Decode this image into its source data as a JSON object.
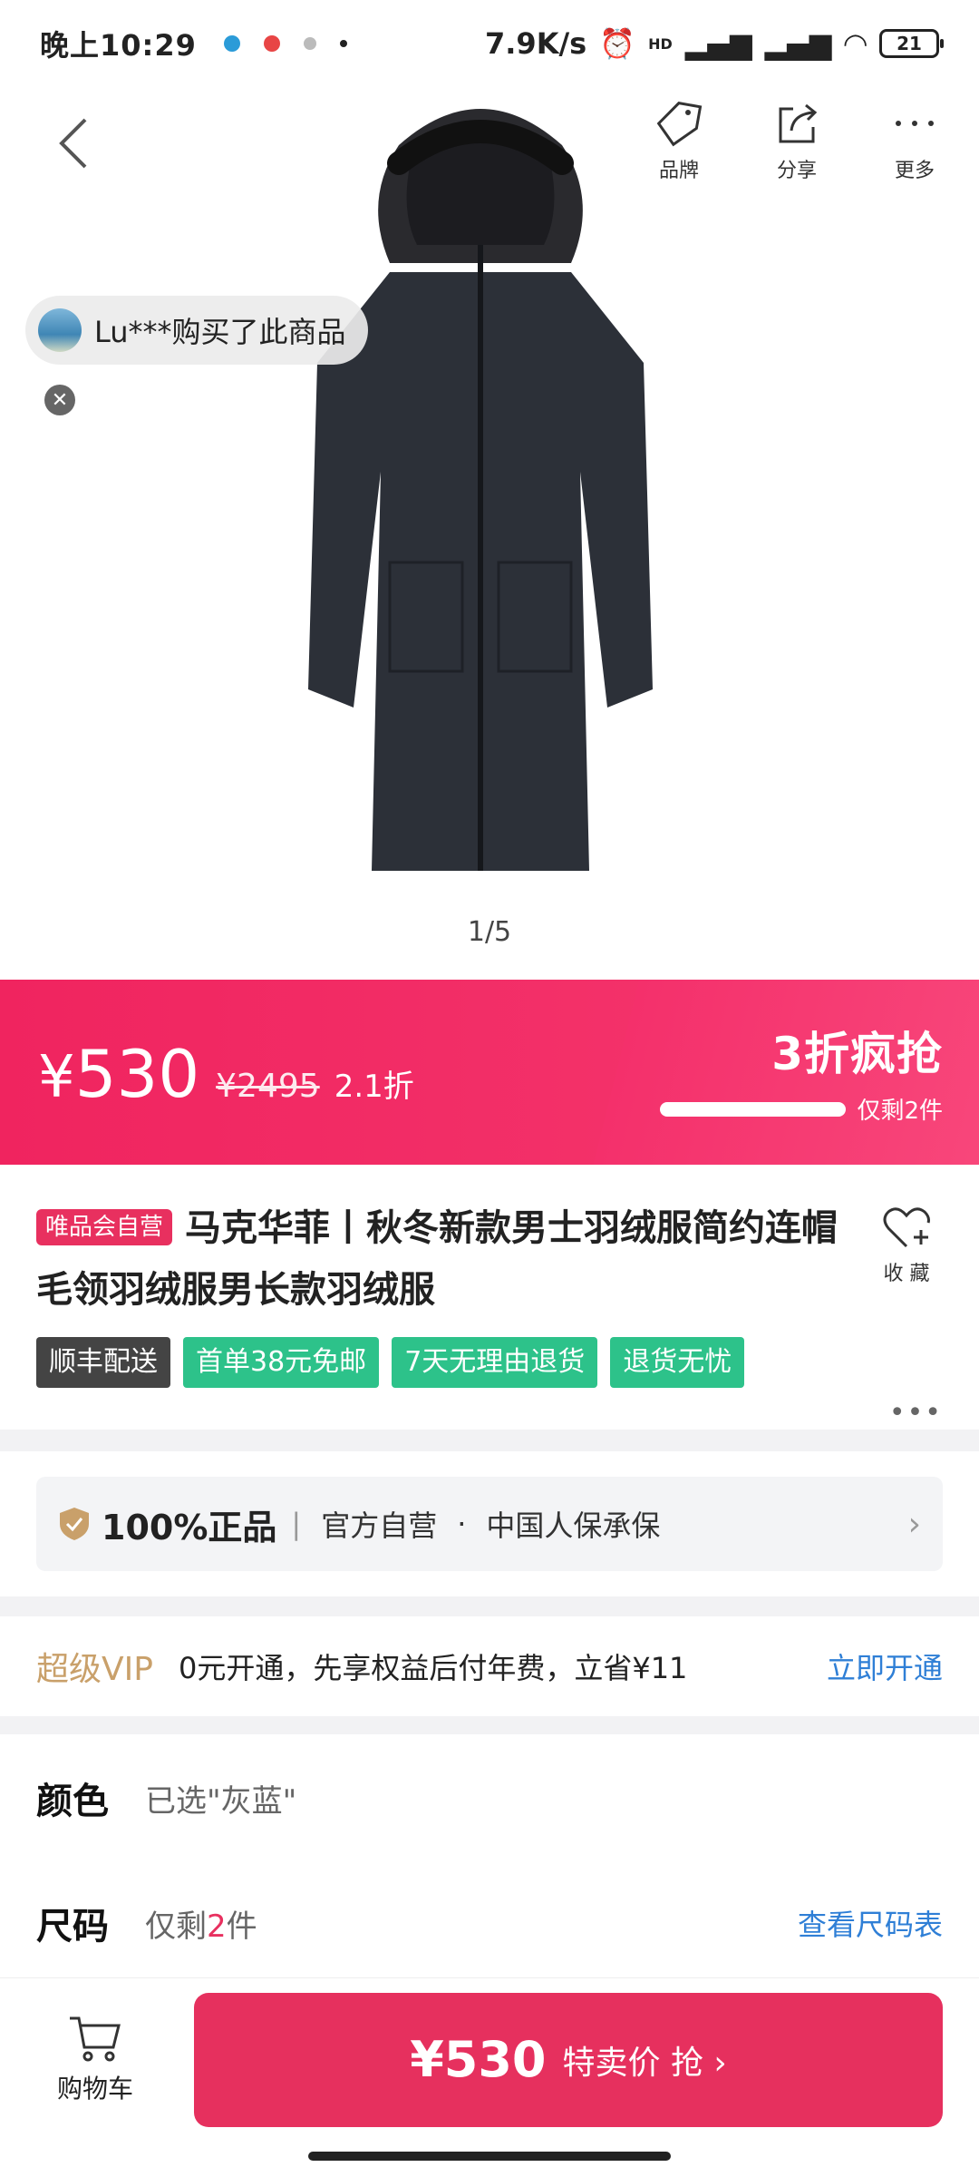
{
  "status_bar": {
    "time": "晚上10:29",
    "net_speed": "7.9K/s",
    "hd": "HD",
    "battery": "21"
  },
  "header": {
    "brand_label": "品牌",
    "share_label": "分享",
    "more_label": "更多"
  },
  "gallery": {
    "buyer_notice": "Lu***购买了此商品",
    "pager": "1/5"
  },
  "price": {
    "currency": "¥",
    "current": "530",
    "original": "¥2495",
    "discount": "2.1折",
    "promo_title": "3折疯抢",
    "stock_left": "仅剩2件",
    "stock_fraction": 0.95
  },
  "product": {
    "self_badge": "唯品会自营",
    "title": "马克华菲丨秋冬新款男士羽绒服简约连帽毛领羽绒服男长款羽绒服",
    "favorite_label": "收 藏",
    "tags": [
      "顺丰配送",
      "首单38元免邮",
      "7天无理由退货",
      "退货无忧"
    ],
    "more": "•••"
  },
  "authenticity": {
    "main": "100%正品",
    "divider": "|",
    "official": "官方自营",
    "dot": "·",
    "insurer": "中国人保承保"
  },
  "vip": {
    "tag": "超级VIP",
    "text": "0元开通，先享权益后付年费，立省¥11",
    "link": "立即开通"
  },
  "options": {
    "color_label": "颜色",
    "color_value": "已选\"灰蓝\"",
    "size_label": "尺码",
    "size_prefix": "仅剩",
    "size_count": "2",
    "size_suffix": "件",
    "size_chart_link": "查看尺码表"
  },
  "bottom": {
    "cart_label": "购物车",
    "buy_price": "¥530",
    "buy_text": "特卖价 抢 ›"
  },
  "colors": {
    "accent": "#e8305f",
    "green_tag": "#2dc28a",
    "link_blue": "#2f7fd6",
    "vip_gold": "#c9a06a"
  }
}
